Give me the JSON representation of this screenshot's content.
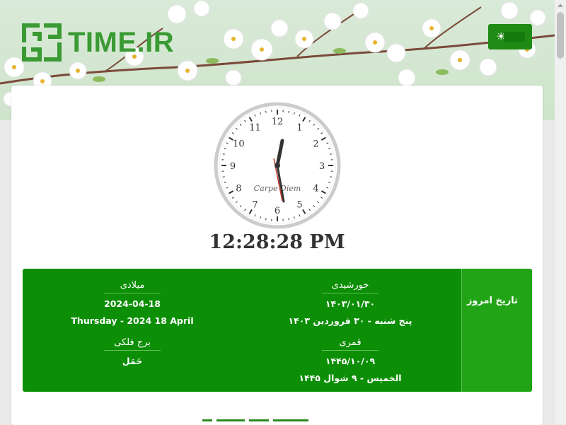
{
  "header": {
    "logo_text": "TIME.IR",
    "theme_icon": "sun-icon",
    "accent": "#1f8a14"
  },
  "clock": {
    "numerals": [
      "12",
      "1",
      "2",
      "3",
      "4",
      "5",
      "6",
      "7",
      "8",
      "9",
      "10",
      "11"
    ],
    "motto": "Carpe Diem",
    "time": "12:28:28 PM"
  },
  "today": {
    "label": "تاریخ امروز",
    "gregorian": {
      "title": "میلادی",
      "date": "2024-04-18",
      "long": "Thursday - 2024 18 April"
    },
    "zodiac": {
      "title": "برج فلکی",
      "value": "حَمَل"
    },
    "shamsi": {
      "title": "خورشیدی",
      "date": "۱۴۰۳/۰۱/۳۰",
      "long": "پنج شنبه - ۳۰ فروردین ۱۴۰۳"
    },
    "qamari": {
      "title": "قمری",
      "date": "۱۴۴۵/۱۰/۰۹",
      "long": "الخميس - ۹ شوال ۱۴۴۵"
    },
    "colors": {
      "box": "#0c8e06",
      "label_col": "#22a417"
    }
  }
}
